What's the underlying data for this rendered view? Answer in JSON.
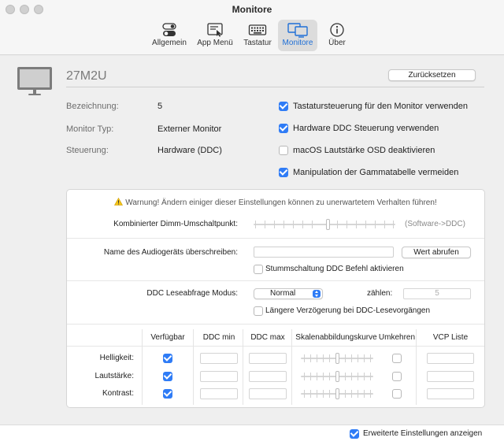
{
  "window": {
    "title": "Monitore"
  },
  "toolbar": {
    "tabs": [
      {
        "label": "Allgemein",
        "icon": "toggles-icon"
      },
      {
        "label": "App Menü",
        "icon": "menu-window-icon"
      },
      {
        "label": "Tastatur",
        "icon": "keyboard-icon"
      },
      {
        "label": "Monitore",
        "icon": "displays-icon",
        "active": true
      },
      {
        "label": "Über",
        "icon": "info-icon"
      }
    ]
  },
  "monitor": {
    "name": "27M2U",
    "reset_label": "Zurücksetzen",
    "info": [
      {
        "key": "Bezeichnung:",
        "value": "5"
      },
      {
        "key": "Monitor Typ:",
        "value": "Externer Monitor"
      },
      {
        "key": "Steuerung:",
        "value": "Hardware (DDC)"
      }
    ],
    "options": [
      {
        "label": "Tastatursteuerung für den Monitor verwenden",
        "checked": true
      },
      {
        "label": "Hardware DDC Steuerung verwenden",
        "checked": true
      },
      {
        "label": "macOS Lautstärke OSD deaktivieren",
        "checked": false
      },
      {
        "label": "Manipulation der Gammatabelle vermeiden",
        "checked": true
      }
    ]
  },
  "advanced": {
    "warning": "Warnung! Ändern einiger dieser Einstellungen können zu unerwartetem Verhalten führen!",
    "dimm": {
      "label": "Kombinierter Dimm-Umschaltpunkt:",
      "note": "(Software->DDC)"
    },
    "audio": {
      "label": "Name des Audiogeräts überschreiben:",
      "value": "",
      "button": "Wert abrufen",
      "mute_label": "Stummschaltung DDC Befehl aktivieren",
      "mute_checked": false
    },
    "ddc": {
      "label": "DDC Leseabfrage Modus:",
      "mode": "Normal",
      "count_label": "zählen:",
      "count_value": "5",
      "delay_label": "Längere Verzögerung bei DDC-Lesevorgängen",
      "delay_checked": false
    },
    "table": {
      "headers": [
        "Verfügbar",
        "DDC min",
        "DDC max",
        "Skalenabbildungskurve",
        "Umkehren",
        "VCP Liste"
      ],
      "rows": [
        {
          "label": "Helligkeit:",
          "available": true,
          "invert": false
        },
        {
          "label": "Lautstärke:",
          "available": true,
          "invert": false
        },
        {
          "label": "Kontrast:",
          "available": true,
          "invert": false
        }
      ]
    }
  },
  "footer": {
    "label": "Erweiterte Einstellungen anzeigen",
    "checked": true
  },
  "colors": {
    "accent": "#2f7cf6",
    "active_tab_text": "#1f6fd6"
  }
}
